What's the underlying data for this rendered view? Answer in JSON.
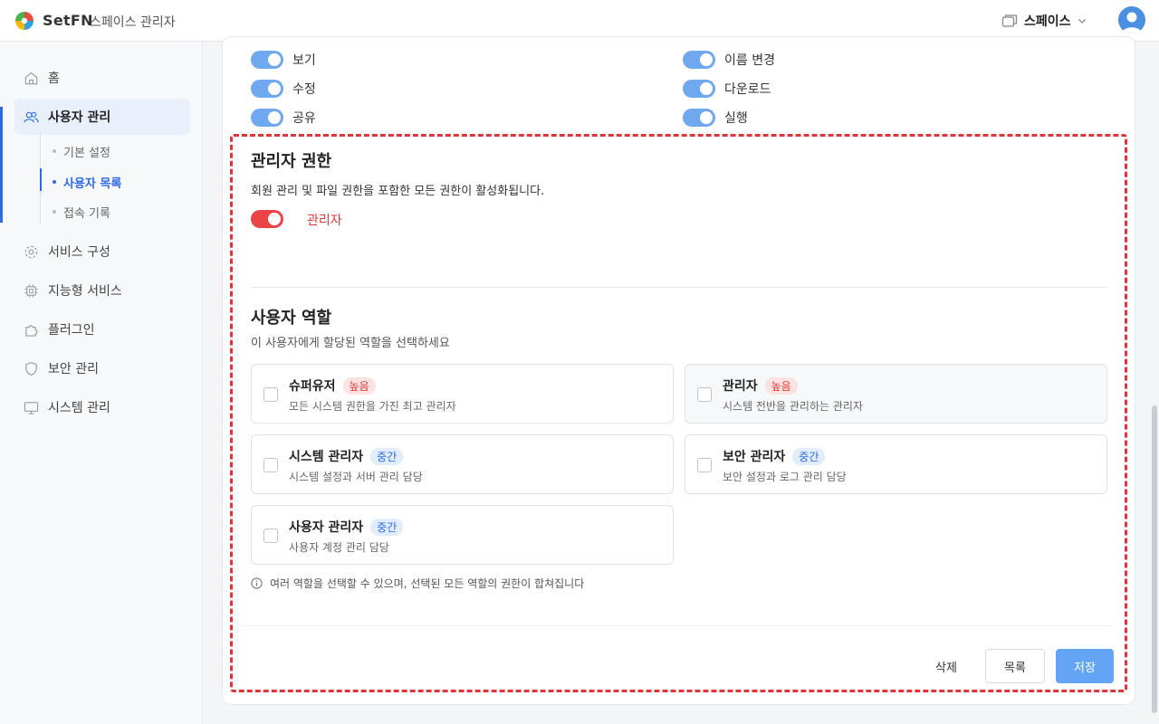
{
  "header": {
    "brand": "SetFN",
    "app_title": "스페이스 관리자",
    "space_label": "스페이스"
  },
  "sidebar": {
    "items": [
      {
        "label": "홈",
        "icon": "home-icon"
      },
      {
        "label": "사용자 관리",
        "icon": "users-icon",
        "active": true
      },
      {
        "label": "서비스 구성",
        "icon": "gear-icon"
      },
      {
        "label": "지능형 서비스",
        "icon": "chip-icon"
      },
      {
        "label": "플러그인",
        "icon": "puzzle-icon"
      },
      {
        "label": "보안 관리",
        "icon": "shield-icon"
      },
      {
        "label": "시스템 관리",
        "icon": "monitor-icon"
      }
    ],
    "sub_items": [
      {
        "label": "기본 설정"
      },
      {
        "label": "사용자 목록",
        "active": true
      },
      {
        "label": "접속 기록"
      }
    ]
  },
  "permissions": [
    {
      "label": "보기",
      "on": true
    },
    {
      "label": "이름 변경",
      "on": true
    },
    {
      "label": "수정",
      "on": true
    },
    {
      "label": "다운로드",
      "on": true
    },
    {
      "label": "공유",
      "on": true
    },
    {
      "label": "실행",
      "on": true
    }
  ],
  "admin_section": {
    "title": "관리자 권한",
    "description": "회원 관리 및 파일 권한을 포함한 모든 권한이 활성화됩니다.",
    "toggle_label": "관리자",
    "toggle_on": true
  },
  "roles_section": {
    "title": "사용자 역할",
    "description": "이 사용자에게 할당된 역할을 선택하세요",
    "roles": [
      {
        "name": "슈퍼유저",
        "badge": "높음",
        "level": "high",
        "desc": "모든 시스템 권한을 가진 최고 관리자",
        "checked": false
      },
      {
        "name": "관리자",
        "badge": "높음",
        "level": "high",
        "desc": "시스템 전반을 관리하는 관리자",
        "checked": false
      },
      {
        "name": "시스템 관리자",
        "badge": "중간",
        "level": "mid",
        "desc": "시스템 설정과 서버 관리 담당",
        "checked": false
      },
      {
        "name": "보안 관리자",
        "badge": "중간",
        "level": "mid",
        "desc": "보안 설정과 로그 관리 담당",
        "checked": false
      },
      {
        "name": "사용자 관리자",
        "badge": "중간",
        "level": "mid",
        "desc": "사용자 계정 관리 담당",
        "checked": false
      }
    ],
    "note": "여러 역할을 선택할 수 있으며, 선택된 모든 역할의 권한이 합쳐집니다"
  },
  "actions": {
    "delete": "삭제",
    "list": "목록",
    "save": "저장"
  },
  "colors": {
    "accent": "#2d6be4",
    "toggle_on": "#6fa8ef",
    "admin_toggle": "#ec4446",
    "highlight_border": "#e0343b",
    "save_button": "#64a4f4"
  }
}
